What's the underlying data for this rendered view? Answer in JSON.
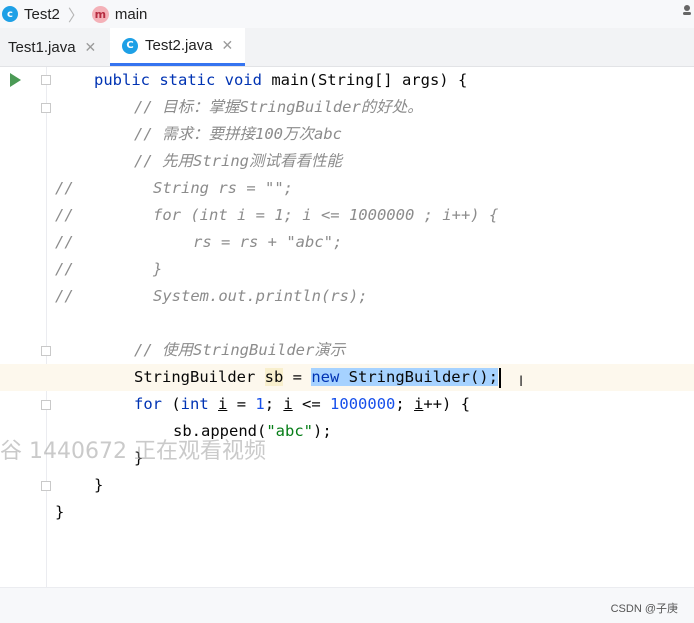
{
  "breadcrumb": {
    "class_name": "Test2",
    "method_name": "main",
    "method_icon_letter": "m",
    "class_icon_letter": "c"
  },
  "tabs": [
    {
      "label": "Test1.java",
      "active": false
    },
    {
      "label": "Test2.java",
      "active": true,
      "icon_letter": "C"
    }
  ],
  "code": {
    "l1": {
      "p1": "public static void ",
      "p2": "main(String[] args) {"
    },
    "l2": "// 目标：掌握StringBuilder的好处。",
    "l3": "// 需求：要拼接100万次abc",
    "l4": "// 先用String测试看看性能",
    "l5": {
      "slashes": "//",
      "text": "String rs = \"\";"
    },
    "l6": {
      "slashes": "//",
      "text": "for (int i = 1; i <= 1000000 ; i++) {"
    },
    "l7": {
      "slashes": "//",
      "text": "rs = rs + \"abc\";"
    },
    "l8": {
      "slashes": "//",
      "text": "}"
    },
    "l9": {
      "slashes": "//",
      "text": "System.out.println(rs);"
    },
    "l11": "// 使用StringBuilder演示",
    "l12": {
      "type": "StringBuilder ",
      "var": "sb",
      "eq": " = ",
      "kw_new": "new",
      "ctor": " StringBuilder();"
    },
    "l13": {
      "kw_for": "for",
      "p1": " (",
      "kw_int": "int",
      "sp": " ",
      "i1": "i",
      "p2": " = ",
      "n1": "1",
      "p3": "; ",
      "i2": "i",
      "p4": " <= ",
      "n2": "1000000",
      "p5": "; ",
      "i3": "i",
      "p6": "++) {"
    },
    "l14": {
      "p1": "sb.append(",
      "s1": "\"abc\"",
      "p2": ");"
    },
    "l15": "}",
    "l16": "}",
    "l17": "}"
  },
  "watermark": "谷 1440672 正在观看视频",
  "footer": {
    "credit": "CSDN @子庚"
  },
  "colors": {
    "keyword": "#0033b3",
    "number": "#1750eb",
    "string": "#067d17",
    "comment": "#8c8c8c",
    "selection": "#a6d2ff",
    "run": "#4b9a56"
  }
}
